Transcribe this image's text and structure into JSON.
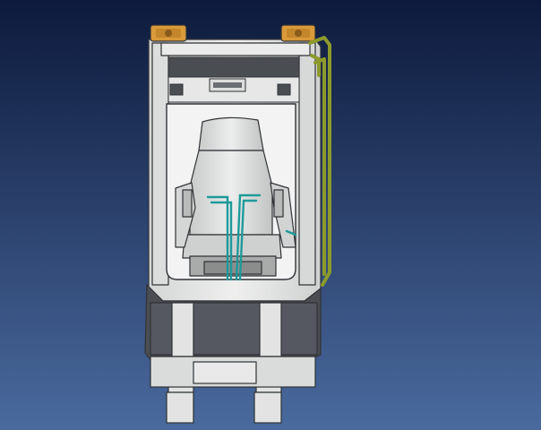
{
  "viewport": {
    "background_top": "#0d1a3c",
    "background_bottom": "#4a6a9e"
  },
  "colors": {
    "cab_frame": "#e3e4e3",
    "cab_frame_shade": "#bdbfbe",
    "cab_dark": "#4a4d52",
    "seat": "#dfe0df",
    "seat_shade": "#b5b7b6",
    "beacon": "#d99a3a",
    "handrail": "#8c9a2c",
    "hydraulic_line": "#1e9a9a",
    "outline": "#303236"
  }
}
